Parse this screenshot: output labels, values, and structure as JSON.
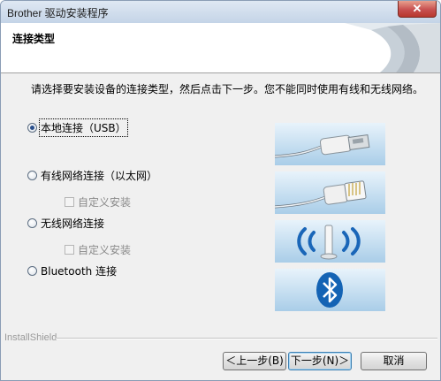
{
  "window": {
    "title": "Brother 驱动安装程序",
    "close_label": "✕"
  },
  "header": {
    "title": "连接类型"
  },
  "instruction": "请选择要安装设备的连接类型，然后点击下一步。您不能同时使用有线和无线网络。",
  "options": [
    {
      "label": "本地连接（USB）",
      "selected": true
    },
    {
      "label": "有线网络连接（以太网）",
      "selected": false,
      "sub": "自定义安装"
    },
    {
      "label": "无线网络连接",
      "selected": false,
      "sub": "自定义安装"
    },
    {
      "label": "Bluetooth 连接",
      "selected": false
    }
  ],
  "footer": {
    "brand": "InstallShield",
    "back_label": "＜上一步(B)",
    "next_label": "下一步(N)＞",
    "cancel_label": "取消"
  },
  "icons": [
    "usb-cable-icon",
    "ethernet-cable-icon",
    "wireless-icon",
    "bluetooth-icon"
  ],
  "colors": {
    "accent_blue": "#1a66b8",
    "panel_blue": "#a9cde8"
  }
}
